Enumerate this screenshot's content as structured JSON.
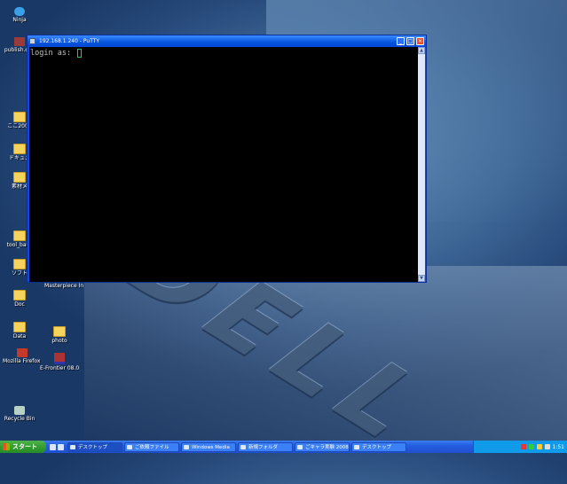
{
  "window": {
    "title": "192.168.1.240 - PuTTY",
    "terminal_prompt": "login as: "
  },
  "desktop_icons": [
    {
      "label": "Ninja",
      "type": "app"
    },
    {
      "label": "publish.doc",
      "type": "app"
    },
    {
      "label": "ここ2005",
      "type": "folder"
    },
    {
      "label": "ドキュメ",
      "type": "folder"
    },
    {
      "label": "素材メ",
      "type": "folder"
    },
    {
      "label": "tool_back",
      "type": "folder"
    },
    {
      "label": "ソフト",
      "type": "folder"
    },
    {
      "label": "Doc",
      "type": "folder"
    },
    {
      "label": "Data",
      "type": "folder"
    },
    {
      "label": "Masterpiece Information",
      "type": "app"
    },
    {
      "label": "Recycle Bin",
      "type": "recycle"
    },
    {
      "label": "Mozilla Firefox Collection",
      "type": "app"
    },
    {
      "label": "photo",
      "type": "folder"
    },
    {
      "label": "E-Frontier 08.08.00",
      "type": "app"
    }
  ],
  "taskbar": {
    "start_label": "スタート",
    "tasks": [
      "デスクトップ",
      "ご依頼ファイル",
      "Windows Media",
      "新規フォルダ",
      "ごキャラ実験 2008",
      "デスクトップ"
    ],
    "clock": "1:51"
  }
}
